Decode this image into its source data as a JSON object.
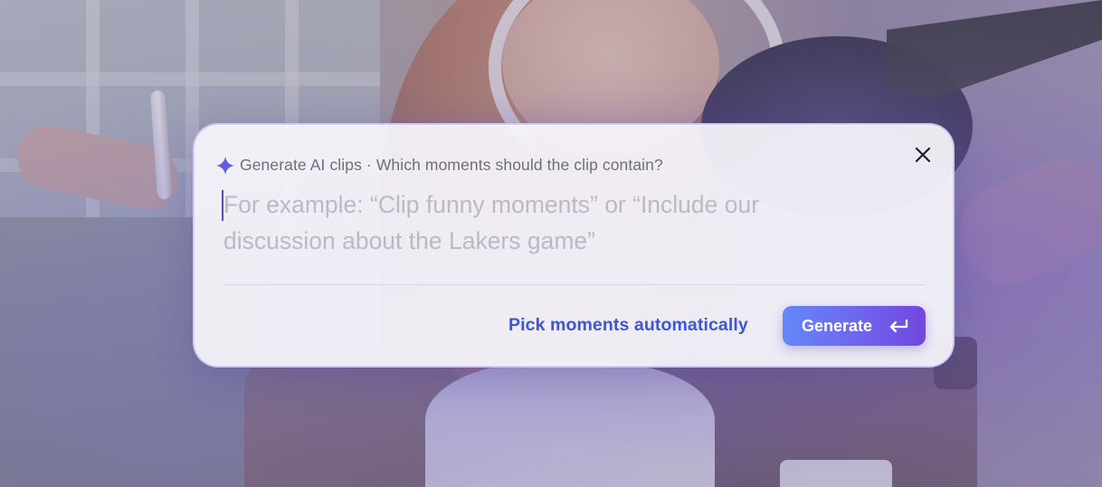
{
  "dialog": {
    "header": {
      "icon": "sparkle-icon",
      "text": "Generate AI clips · Which moments should the clip contain?"
    },
    "close_icon": "close-icon",
    "prompt": {
      "value": "",
      "placeholder": "For example: “Clip funny moments” or “Include our discussion about the Lakers game”"
    },
    "actions": {
      "auto_link_label": "Pick moments automatically",
      "generate_label": "Generate",
      "generate_icon": "enter-return-icon"
    }
  },
  "colors": {
    "accent_blue": "#3d55d6",
    "button_gradient_start": "#6488f7",
    "button_gradient_end": "#7446df",
    "sparkle": "#5b5fe0"
  }
}
